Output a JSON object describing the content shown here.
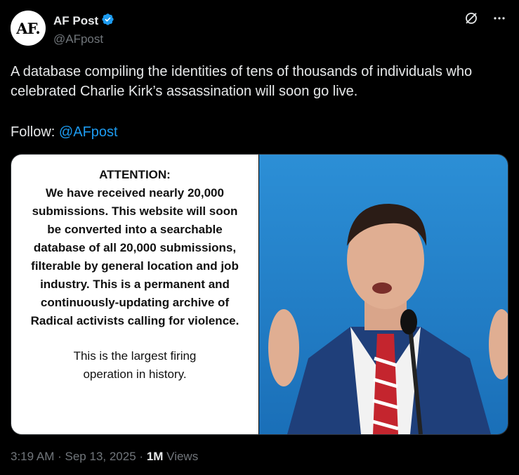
{
  "author": {
    "avatar_text": "AF.",
    "display_name": "AF Post",
    "handle": "@AFpost",
    "verified": true
  },
  "icons": [
    "verified-badge-icon",
    "grok-icon",
    "more-icon"
  ],
  "tweet": {
    "text": "A database compiling the identities of tens of thousands of individuals who celebrated Charlie Kirk’s assassination will soon go live.",
    "follow_label": "Follow:",
    "follow_link": "@AFpost"
  },
  "media": {
    "notice": {
      "title": "ATTENTION:",
      "body": "We have received nearly 20,000 submissions. This website will soon be converted into a searchable database of all 20,000 submissions, filterable by general location and job industry. This is a permanent and continuously-updating archive of Radical activists calling for violence.",
      "footer": "This is the largest firing operation in history."
    }
  },
  "meta": {
    "time": "3:19 AM",
    "date": "Sep 13, 2025",
    "views_count": "1M",
    "views_label": "Views"
  },
  "colors": {
    "background": "#000000",
    "text": "#e7e9ea",
    "muted": "#71767b",
    "link": "#1d9bf0",
    "verified": "#1d9bf0"
  }
}
